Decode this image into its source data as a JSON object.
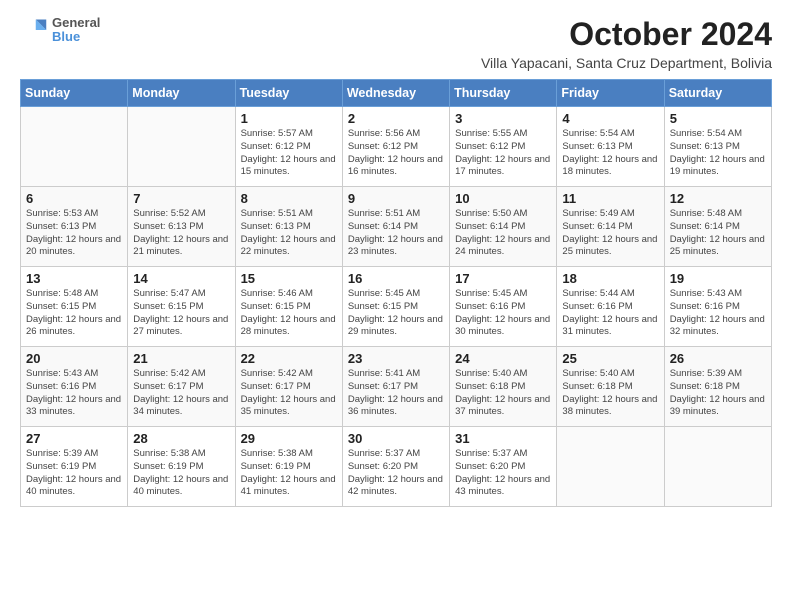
{
  "header": {
    "logo_line1": "General",
    "logo_line2": "Blue",
    "month_title": "October 2024",
    "location": "Villa Yapacani, Santa Cruz Department, Bolivia"
  },
  "days_of_week": [
    "Sunday",
    "Monday",
    "Tuesday",
    "Wednesday",
    "Thursday",
    "Friday",
    "Saturday"
  ],
  "weeks": [
    [
      {
        "num": "",
        "info": ""
      },
      {
        "num": "",
        "info": ""
      },
      {
        "num": "1",
        "info": "Sunrise: 5:57 AM\nSunset: 6:12 PM\nDaylight: 12 hours and 15 minutes."
      },
      {
        "num": "2",
        "info": "Sunrise: 5:56 AM\nSunset: 6:12 PM\nDaylight: 12 hours and 16 minutes."
      },
      {
        "num": "3",
        "info": "Sunrise: 5:55 AM\nSunset: 6:12 PM\nDaylight: 12 hours and 17 minutes."
      },
      {
        "num": "4",
        "info": "Sunrise: 5:54 AM\nSunset: 6:13 PM\nDaylight: 12 hours and 18 minutes."
      },
      {
        "num": "5",
        "info": "Sunrise: 5:54 AM\nSunset: 6:13 PM\nDaylight: 12 hours and 19 minutes."
      }
    ],
    [
      {
        "num": "6",
        "info": "Sunrise: 5:53 AM\nSunset: 6:13 PM\nDaylight: 12 hours and 20 minutes."
      },
      {
        "num": "7",
        "info": "Sunrise: 5:52 AM\nSunset: 6:13 PM\nDaylight: 12 hours and 21 minutes."
      },
      {
        "num": "8",
        "info": "Sunrise: 5:51 AM\nSunset: 6:13 PM\nDaylight: 12 hours and 22 minutes."
      },
      {
        "num": "9",
        "info": "Sunrise: 5:51 AM\nSunset: 6:14 PM\nDaylight: 12 hours and 23 minutes."
      },
      {
        "num": "10",
        "info": "Sunrise: 5:50 AM\nSunset: 6:14 PM\nDaylight: 12 hours and 24 minutes."
      },
      {
        "num": "11",
        "info": "Sunrise: 5:49 AM\nSunset: 6:14 PM\nDaylight: 12 hours and 25 minutes."
      },
      {
        "num": "12",
        "info": "Sunrise: 5:48 AM\nSunset: 6:14 PM\nDaylight: 12 hours and 25 minutes."
      }
    ],
    [
      {
        "num": "13",
        "info": "Sunrise: 5:48 AM\nSunset: 6:15 PM\nDaylight: 12 hours and 26 minutes."
      },
      {
        "num": "14",
        "info": "Sunrise: 5:47 AM\nSunset: 6:15 PM\nDaylight: 12 hours and 27 minutes."
      },
      {
        "num": "15",
        "info": "Sunrise: 5:46 AM\nSunset: 6:15 PM\nDaylight: 12 hours and 28 minutes."
      },
      {
        "num": "16",
        "info": "Sunrise: 5:45 AM\nSunset: 6:15 PM\nDaylight: 12 hours and 29 minutes."
      },
      {
        "num": "17",
        "info": "Sunrise: 5:45 AM\nSunset: 6:16 PM\nDaylight: 12 hours and 30 minutes."
      },
      {
        "num": "18",
        "info": "Sunrise: 5:44 AM\nSunset: 6:16 PM\nDaylight: 12 hours and 31 minutes."
      },
      {
        "num": "19",
        "info": "Sunrise: 5:43 AM\nSunset: 6:16 PM\nDaylight: 12 hours and 32 minutes."
      }
    ],
    [
      {
        "num": "20",
        "info": "Sunrise: 5:43 AM\nSunset: 6:16 PM\nDaylight: 12 hours and 33 minutes."
      },
      {
        "num": "21",
        "info": "Sunrise: 5:42 AM\nSunset: 6:17 PM\nDaylight: 12 hours and 34 minutes."
      },
      {
        "num": "22",
        "info": "Sunrise: 5:42 AM\nSunset: 6:17 PM\nDaylight: 12 hours and 35 minutes."
      },
      {
        "num": "23",
        "info": "Sunrise: 5:41 AM\nSunset: 6:17 PM\nDaylight: 12 hours and 36 minutes."
      },
      {
        "num": "24",
        "info": "Sunrise: 5:40 AM\nSunset: 6:18 PM\nDaylight: 12 hours and 37 minutes."
      },
      {
        "num": "25",
        "info": "Sunrise: 5:40 AM\nSunset: 6:18 PM\nDaylight: 12 hours and 38 minutes."
      },
      {
        "num": "26",
        "info": "Sunrise: 5:39 AM\nSunset: 6:18 PM\nDaylight: 12 hours and 39 minutes."
      }
    ],
    [
      {
        "num": "27",
        "info": "Sunrise: 5:39 AM\nSunset: 6:19 PM\nDaylight: 12 hours and 40 minutes."
      },
      {
        "num": "28",
        "info": "Sunrise: 5:38 AM\nSunset: 6:19 PM\nDaylight: 12 hours and 40 minutes."
      },
      {
        "num": "29",
        "info": "Sunrise: 5:38 AM\nSunset: 6:19 PM\nDaylight: 12 hours and 41 minutes."
      },
      {
        "num": "30",
        "info": "Sunrise: 5:37 AM\nSunset: 6:20 PM\nDaylight: 12 hours and 42 minutes."
      },
      {
        "num": "31",
        "info": "Sunrise: 5:37 AM\nSunset: 6:20 PM\nDaylight: 12 hours and 43 minutes."
      },
      {
        "num": "",
        "info": ""
      },
      {
        "num": "",
        "info": ""
      }
    ]
  ]
}
